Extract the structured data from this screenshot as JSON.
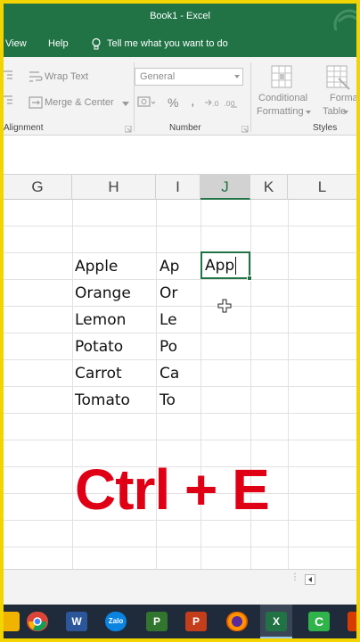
{
  "titlebar": {
    "title": "Book1  -  Excel"
  },
  "menubar": {
    "view": "View",
    "help": "Help",
    "tell_me": "Tell me what you want to do"
  },
  "ribbon": {
    "wrap_text": "Wrap Text",
    "merge_center": "Merge & Center",
    "number_format": "General",
    "number_symbols": {
      "percent": "%",
      "comma": ","
    },
    "conditional_formatting": [
      "Conditional",
      "Formatting"
    ],
    "format_as_table": [
      "Format as",
      "Table"
    ],
    "groups": {
      "alignment": "Alignment",
      "number": "Number",
      "styles": "Styles"
    }
  },
  "columns": [
    "G",
    "H",
    "I",
    "J",
    "K",
    "L"
  ],
  "selected_column": "J",
  "cells": {
    "H": [
      "Apple",
      "Orange",
      "Lemon",
      "Potato",
      "Carrot",
      "Tomato"
    ],
    "I": [
      "Ap",
      "Or",
      "Le",
      "Po",
      "Ca",
      "To"
    ]
  },
  "active_cell": {
    "column": "J",
    "value": "App"
  },
  "overlay_text": "Ctrl + E",
  "colors": {
    "excel_green": "#217346",
    "overlay_red": "#e00015",
    "frame_yellow": "#f2d400"
  },
  "taskbar_icons": [
    "files-icon",
    "chrome-icon",
    "word-icon",
    "zalo-icon",
    "project-icon",
    "powerpoint-icon",
    "firefox-icon",
    "excel-icon",
    "camtasia-icon",
    "office-icon"
  ]
}
